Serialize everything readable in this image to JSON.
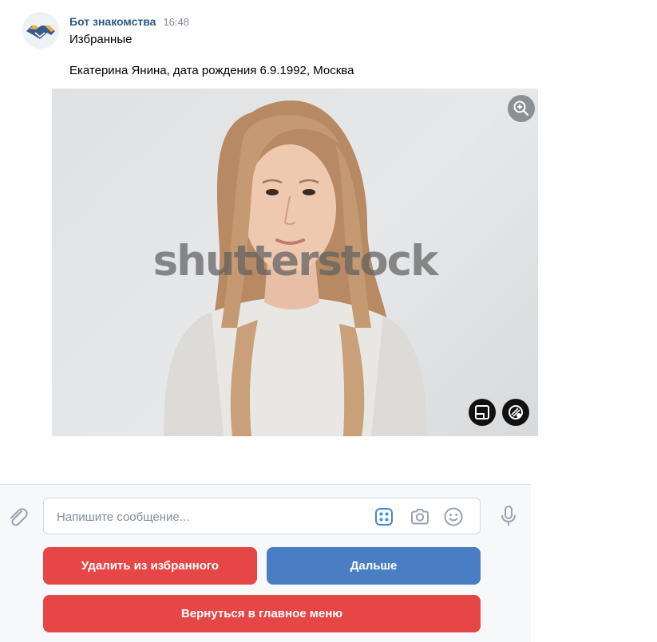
{
  "message": {
    "sender": "Бот знакомства",
    "time": "16:48",
    "line1": "Избранные",
    "line2": "Екатерина Янина, дата рождения 6.9.1992, Москва"
  },
  "photo": {
    "watermark": "shutterstock",
    "icons": [
      "zoom-in-icon",
      "crop-icon",
      "ai-edit-icon"
    ]
  },
  "composer": {
    "placeholder": "Напишите сообщение...",
    "icons": [
      "paperclip-icon",
      "bot-keyboard-icon",
      "camera-icon",
      "emoji-icon",
      "microphone-icon"
    ]
  },
  "keyboard": {
    "remove_label": "Удалить из избранного",
    "next_label": "Дальше",
    "menu_label": "Вернуться в главное меню"
  },
  "colors": {
    "sender": "#2a5885",
    "button_red": "#e64646",
    "button_blue": "#4a7ec4",
    "composer_bg": "#f7f8fa"
  }
}
